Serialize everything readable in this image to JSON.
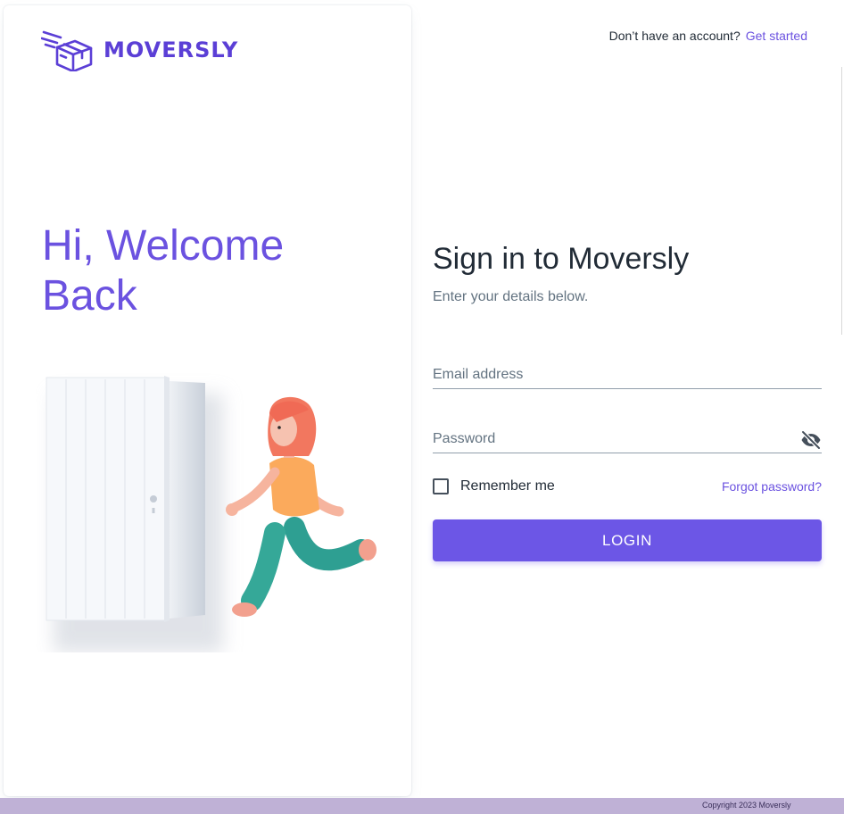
{
  "brand": {
    "name": "MOVERSLY",
    "logo_icon": "moving-box-icon",
    "color": "#5b3fd6"
  },
  "hero": {
    "title": "Hi, Welcome Back"
  },
  "header": {
    "prompt": "Don’t have an account?",
    "link": "Get started"
  },
  "form": {
    "title": "Sign in to Moversly",
    "subtitle": "Enter your details below.",
    "email_placeholder": "Email address",
    "password_placeholder": "Password",
    "password_toggle_icon": "eye-off-icon",
    "remember_label": "Remember me",
    "remember_checked": false,
    "forgot_label": "Forgot password?",
    "login_label": "LOGIN"
  },
  "footer": {
    "copyright": "Copyright 2023 Moversly"
  },
  "colors": {
    "accent": "#6c56e6",
    "footer_bg": "#bfb1d6"
  }
}
